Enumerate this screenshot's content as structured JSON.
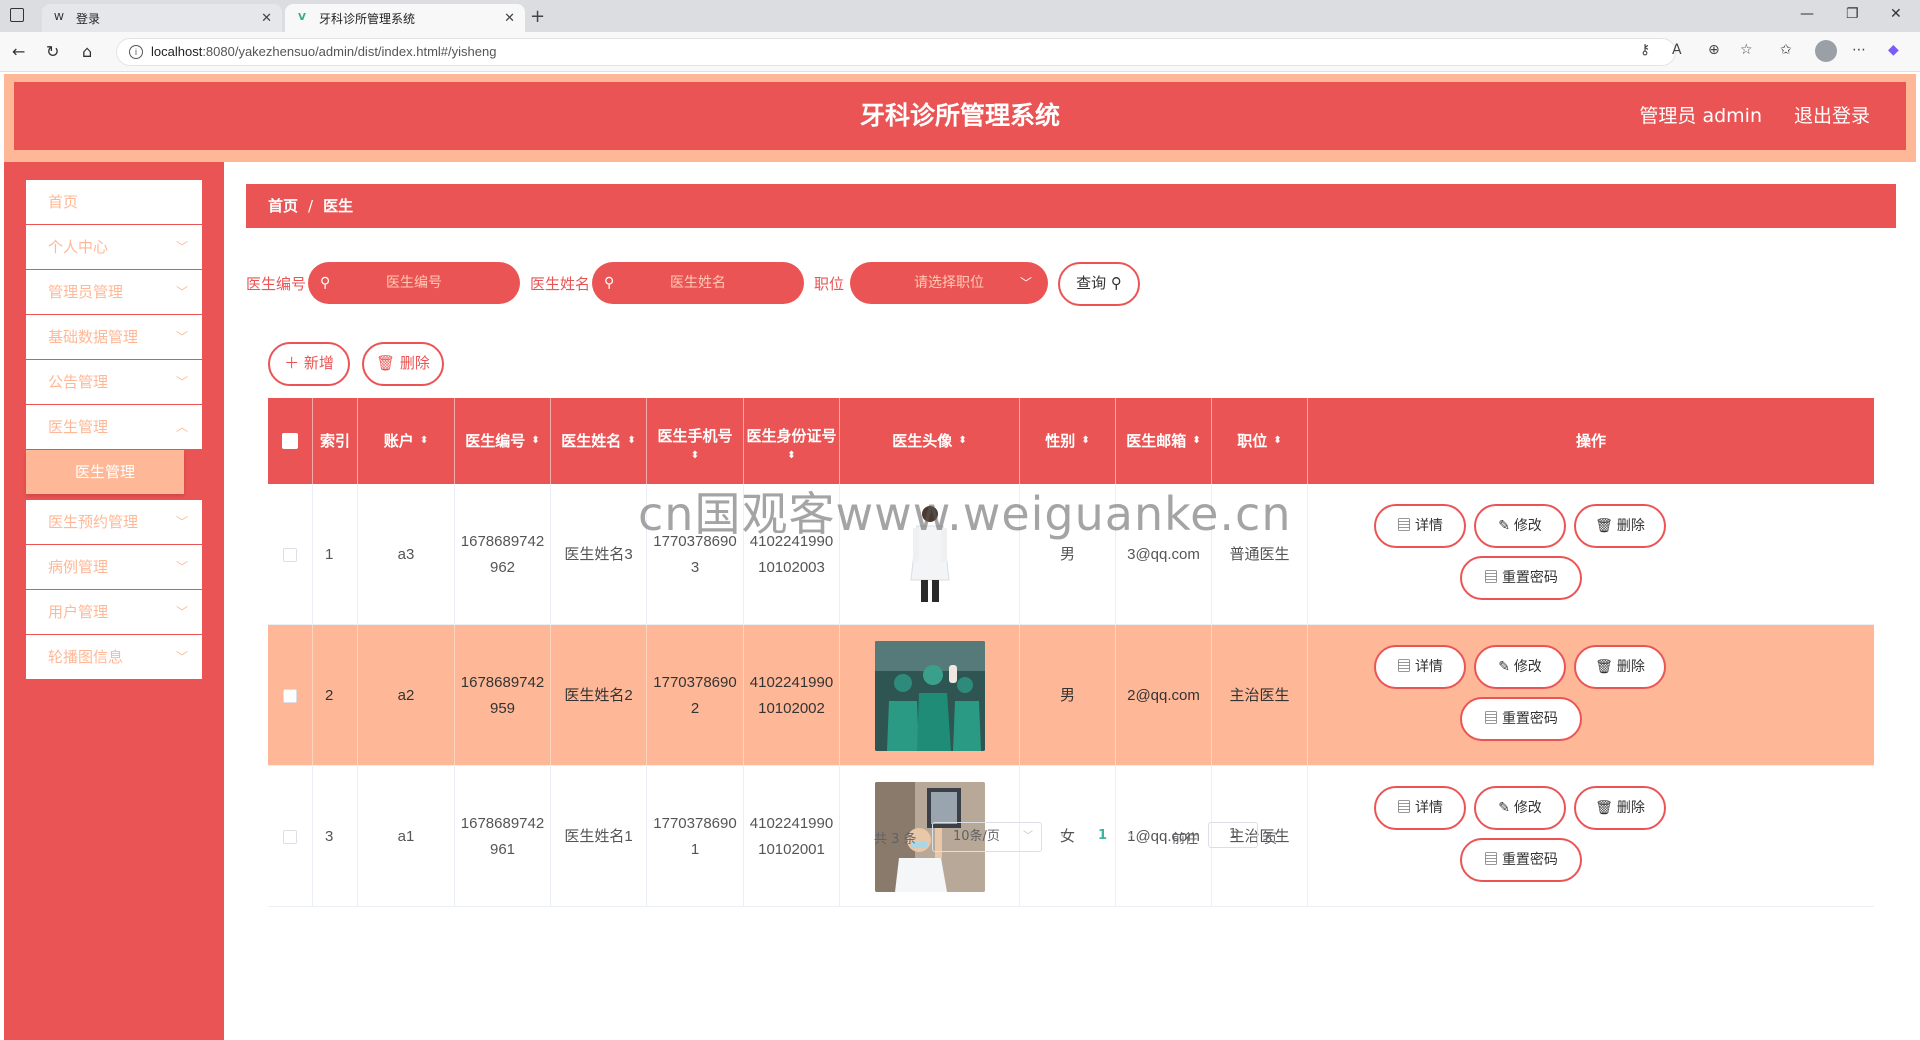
{
  "browser": {
    "tabs": [
      {
        "title": "登录",
        "favicon": "W"
      },
      {
        "title": "牙科诊所管理系统",
        "favicon": "V"
      }
    ],
    "url_host": "localhost",
    "url_rest": ":8080/yakezhensuo/admin/dist/index.html#/yisheng"
  },
  "header": {
    "title": "牙科诊所管理系统",
    "user": "管理员 admin",
    "logout": "退出登录"
  },
  "sidebar": {
    "items": [
      {
        "label": "首页"
      },
      {
        "label": "个人中心"
      },
      {
        "label": "管理员管理"
      },
      {
        "label": "基础数据管理"
      },
      {
        "label": "公告管理"
      },
      {
        "label": "医生管理"
      },
      {
        "label": "医生预约管理"
      },
      {
        "label": "病例管理"
      },
      {
        "label": "用户管理"
      },
      {
        "label": "轮播图信息"
      }
    ],
    "active_sub": "医生管理"
  },
  "breadcrumb": {
    "home": "首页",
    "sep": "/",
    "current": "医生"
  },
  "search": {
    "label_code": "医生编号",
    "placeholder_code": "医生编号",
    "label_name": "医生姓名",
    "placeholder_name": "医生姓名",
    "label_position": "职位",
    "placeholder_position": "请选择职位",
    "query": "查询"
  },
  "actions": {
    "add": "新增",
    "delete": "删除"
  },
  "table": {
    "headers": {
      "index": "索引",
      "account": "账户",
      "code": "医生编号",
      "name": "医生姓名",
      "phone": "医生手机号",
      "idcard": "医生身份证号",
      "avatar": "医生头像",
      "gender": "性别",
      "email": "医生邮箱",
      "position": "职位",
      "ops": "操作"
    },
    "rows": [
      {
        "index": "1",
        "account": "a3",
        "code1": "1678689742",
        "code2": "962",
        "name": "医生姓名3",
        "phone1": "1770378690",
        "phone2": "3",
        "id1": "4102241990",
        "id2": "10102003",
        "gender": "男",
        "email": "3@qq.com",
        "position": "普通医生"
      },
      {
        "index": "2",
        "account": "a2",
        "code1": "1678689742",
        "code2": "959",
        "name": "医生姓名2",
        "phone1": "1770378690",
        "phone2": "2",
        "id1": "4102241990",
        "id2": "10102002",
        "gender": "男",
        "email": "2@qq.com",
        "position": "主治医生"
      },
      {
        "index": "3",
        "account": "a1",
        "code1": "1678689742",
        "code2": "961",
        "name": "医生姓名1",
        "phone1": "1770378690",
        "phone2": "1",
        "id1": "4102241990",
        "id2": "10102001",
        "gender": "女",
        "email": "1@qq.com",
        "position": "主治医生"
      }
    ],
    "ops": {
      "detail": "详情",
      "edit": "修改",
      "delete": "删除",
      "reset": "重置密码"
    }
  },
  "pager": {
    "total": "共 3 条",
    "size": "10条/页",
    "current": "1",
    "goto": "前往",
    "goto_value": "1",
    "page": "页"
  },
  "watermark": "cn国观客www.weiguanke.cn",
  "colors": {
    "primary": "#eb5454",
    "accent": "#ffb897"
  }
}
